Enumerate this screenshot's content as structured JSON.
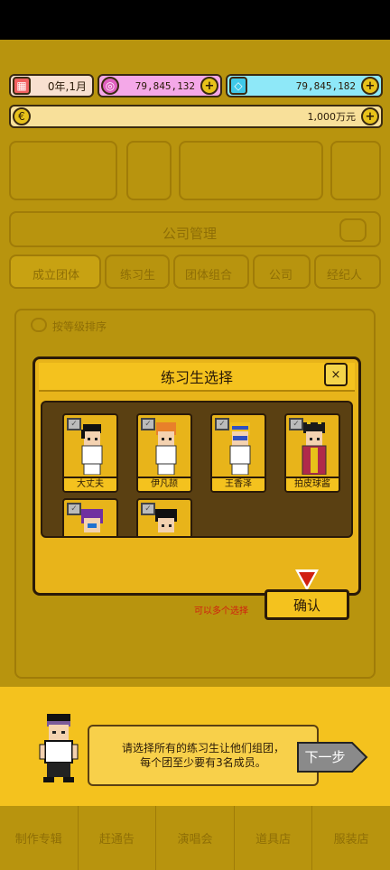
{
  "resources": {
    "date": "0年,1月",
    "pink_currency": "79,845,132",
    "gem_currency": "79,845,182",
    "money": "1,000万元"
  },
  "background": {
    "section_title": "公司管理",
    "tabs": [
      "成立团体",
      "练习生",
      "团体组合",
      "公司",
      "经纪人"
    ],
    "sort_label": "按等级排序",
    "bottom_nav": [
      "制作专辑",
      "赶通告",
      "演唱会",
      "道具店",
      "服装店"
    ]
  },
  "modal": {
    "title": "练习生选择",
    "close_label": "×",
    "trainees": [
      {
        "name": "大丈夫",
        "hair": "#111111",
        "outfit": "#ffffff"
      },
      {
        "name": "伊凡颉",
        "hair": "#e8802a",
        "outfit": "#ffffff"
      },
      {
        "name": "王香泽",
        "hair": "#f0c020",
        "outfit": "#ffffff"
      },
      {
        "name": "拍皮球酱",
        "hair": "#1a1a1a",
        "outfit": "#b02a4a"
      },
      {
        "name": "",
        "hair": "#7030a0",
        "outfit": "#ffffff"
      },
      {
        "name": "",
        "hair": "#111111",
        "outfit": "#ffffff"
      }
    ],
    "hint": "可以多个选择",
    "confirm_label": "确认"
  },
  "tutorial": {
    "message_line1": "请选择所有的练习生让他们组团，",
    "message_line2": "每个团至少要有3名成员。",
    "next_label": "下一步"
  },
  "colors": {
    "accent": "#f4c21e",
    "dark": "#2a1a08",
    "hint": "#d02010"
  }
}
